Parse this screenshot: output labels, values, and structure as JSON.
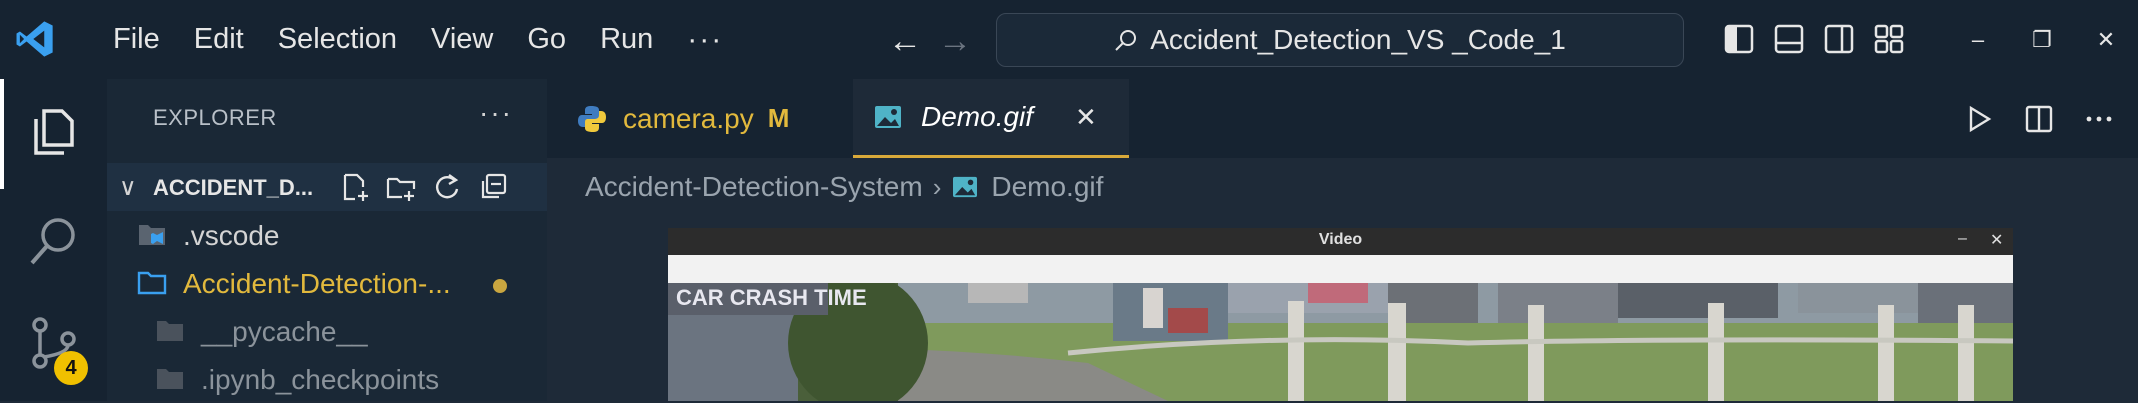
{
  "titlebar": {
    "menu": [
      "File",
      "Edit",
      "Selection",
      "View",
      "Go",
      "Run"
    ],
    "menu_more": "···",
    "command_center": "Accident_Detection_VS _Code_1",
    "window_controls": [
      "–",
      "❐",
      "✕"
    ]
  },
  "activity": {
    "scm_badge": "4"
  },
  "sidebar": {
    "title": "EXPLORER",
    "more": "···",
    "folder_name": "ACCIDENT_D...",
    "items": [
      {
        "label": ".vscode",
        "color": "#d4d4d4"
      },
      {
        "label": "Accident-Detection-...",
        "color": "#e2b93d"
      },
      {
        "label": "__pycache__",
        "color": "#8b939b"
      },
      {
        "label": ".ipynb_checkpoints",
        "color": "#8b939b"
      }
    ]
  },
  "editor": {
    "tabs": [
      {
        "label": "camera.py",
        "badge": "M",
        "active": false
      },
      {
        "label": "Demo.gif",
        "close": "✕",
        "active": true
      }
    ],
    "breadcrumb": [
      "Accident-Detection-System",
      "Demo.gif"
    ],
    "gif": {
      "window_title": "Video",
      "minimize": "–",
      "close": "✕",
      "overlay_text": "CAR CRASH TIME"
    }
  },
  "colors": {
    "accent_tab": "#d9a93a",
    "modified": "#e2b93d",
    "badge": "#f0c000"
  }
}
